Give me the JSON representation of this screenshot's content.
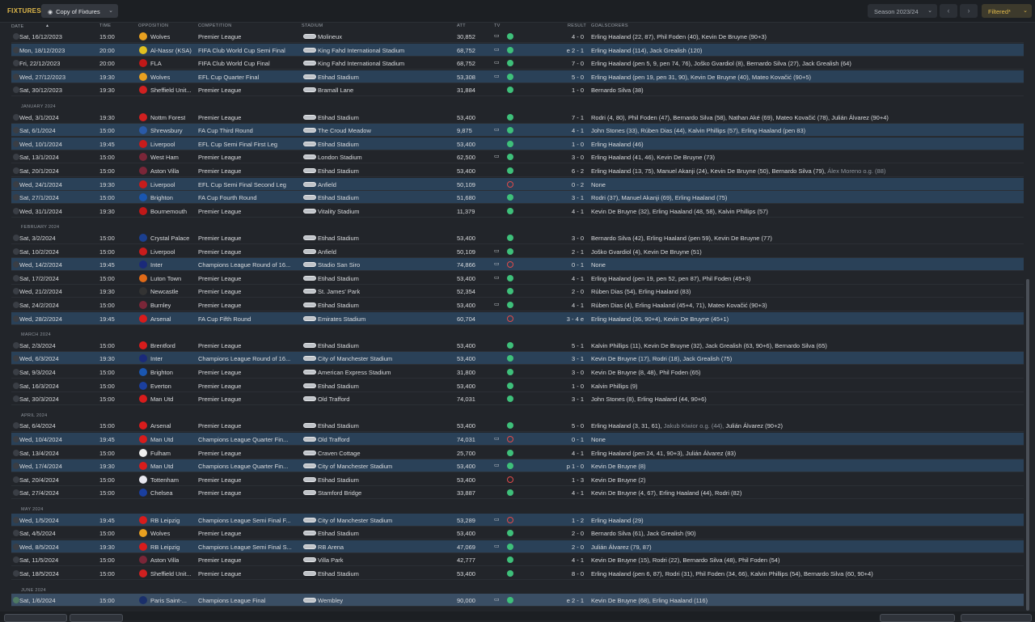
{
  "header": {
    "title": "FIXTURES",
    "view_dropdown": "Copy of Fixtures",
    "season": "Season 2023/24",
    "filter": "Filtered*"
  },
  "columns": {
    "date": "DATE",
    "time": "TIME",
    "opposition": "OPPOSITION",
    "competition": "COMPETITION",
    "stadium": "STADIUM",
    "att": "ATT",
    "tv": "TV",
    "result": "RESULT",
    "goalscorers": "GOALSCORERS"
  },
  "rows": [
    {
      "date": "Sat, 16/12/2023",
      "time": "15:00",
      "opp": "Wolves",
      "comp": "Premier League",
      "stadium": "Molineux",
      "att": "30,852",
      "tv": true,
      "outcome": "win",
      "result": "4 - 0",
      "scorers": "Erling Haaland (22, 87), Phil Foden (40), Kevin De Bruyne (90+3)",
      "badge": "#e8a020",
      "alt": false
    },
    {
      "date": "Mon, 18/12/2023",
      "time": "20:00",
      "opp": "Al-Nassr (KSA)",
      "comp": "FIFA Club World Cup Semi Final",
      "stadium": "King Fahd International Stadium",
      "att": "68,752",
      "tv": true,
      "outcome": "win",
      "result": "e 2 - 1",
      "scorers": "Erling Haaland (114), Jack Grealish (120)",
      "badge": "#e0c020",
      "alt": true
    },
    {
      "date": "Fri, 22/12/2023",
      "time": "20:00",
      "opp": "FLA",
      "comp": "FIFA Club World Cup Final",
      "stadium": "King Fahd International Stadium",
      "att": "68,752",
      "tv": true,
      "outcome": "win",
      "result": "7 - 0",
      "scorers": "Erling Haaland (pen 5, 9, pen 74, 76), Joško Gvardiol (8), Bernardo Silva (27), Jack Grealish (64)",
      "badge": "#c01818",
      "alt": false
    },
    {
      "date": "Wed, 27/12/2023",
      "time": "19:30",
      "opp": "Wolves",
      "comp": "EFL Cup Quarter Final",
      "stadium": "Etihad Stadium",
      "att": "53,308",
      "tv": true,
      "outcome": "win",
      "result": "5 - 0",
      "scorers": "Erling Haaland (pen 19, pen 31, 90), Kevin De Bruyne (40), Mateo Kovačić (90+5)",
      "badge": "#e8a020",
      "alt": true
    },
    {
      "date": "Sat, 30/12/2023",
      "time": "19:30",
      "opp": "Sheffield Unit...",
      "comp": "Premier League",
      "stadium": "Bramall Lane",
      "att": "31,884",
      "tv": false,
      "outcome": "win",
      "result": "1 - 0",
      "scorers": "Bernardo Silva (38)",
      "badge": "#d02020",
      "alt": false
    },
    {
      "month": "JANUARY 2024"
    },
    {
      "date": "Wed, 3/1/2024",
      "time": "19:30",
      "opp": "Nottm Forest",
      "comp": "Premier League",
      "stadium": "Etihad Stadium",
      "att": "53,400",
      "tv": false,
      "outcome": "win",
      "result": "7 - 1",
      "scorers": "Rodri (4, 80), Phil Foden (47), Bernardo Silva (58), Nathan Aké (69), Mateo Kovačić (78), Julián Álvarez (90+4)",
      "badge": "#d02020",
      "alt": false
    },
    {
      "date": "Sat, 6/1/2024",
      "time": "15:00",
      "opp": "Shrewsbury",
      "comp": "FA Cup Third Round",
      "stadium": "The Croud Meadow",
      "att": "9,875",
      "tv": true,
      "outcome": "win",
      "result": "4 - 1",
      "scorers": "John Stones (33), Rúben Dias (44), Kalvin Phillips (57), Erling Haaland (pen 83)",
      "badge": "#2a5aa8",
      "alt": true
    },
    {
      "date": "Wed, 10/1/2024",
      "time": "19:45",
      "opp": "Liverpool",
      "comp": "EFL Cup Semi Final First Leg",
      "stadium": "Etihad Stadium",
      "att": "53,400",
      "tv": false,
      "outcome": "win",
      "result": "1 - 0",
      "scorers": "Erling Haaland (46)",
      "badge": "#c81c1c",
      "alt": true
    },
    {
      "date": "Sat, 13/1/2024",
      "time": "15:00",
      "opp": "West Ham",
      "comp": "Premier League",
      "stadium": "London Stadium",
      "att": "62,500",
      "tv": true,
      "outcome": "win",
      "result": "3 - 0",
      "scorers": "Erling Haaland (41, 46), Kevin De Bruyne (73)",
      "badge": "#7a2638",
      "alt": false
    },
    {
      "date": "Sat, 20/1/2024",
      "time": "15:00",
      "opp": "Aston Villa",
      "comp": "Premier League",
      "stadium": "Etihad Stadium",
      "att": "53,400",
      "tv": false,
      "outcome": "win",
      "result": "6 - 2",
      "scorers": "Erling Haaland (13, 75), Manuel Akanji (24), Kevin De Bruyne (50), Bernardo Silva (79),",
      "scorers_muted": " Álex Moreno o.g. (88)",
      "badge": "#7a2638",
      "alt": false
    },
    {
      "date": "Wed, 24/1/2024",
      "time": "19:30",
      "opp": "Liverpool",
      "comp": "EFL Cup Semi Final Second Leg",
      "stadium": "Anfield",
      "att": "50,109",
      "tv": false,
      "outcome": "loss",
      "result": "0 - 2",
      "scorers": "None",
      "badge": "#c81c1c",
      "alt": true
    },
    {
      "date": "Sat, 27/1/2024",
      "time": "15:00",
      "opp": "Brighton",
      "comp": "FA Cup Fourth Round",
      "stadium": "Etihad Stadium",
      "att": "51,680",
      "tv": false,
      "outcome": "win",
      "result": "3 - 1",
      "scorers": "Rodri (37), Manuel Akanji (69), Erling Haaland (75)",
      "badge": "#1a56b0",
      "alt": true
    },
    {
      "date": "Wed, 31/1/2024",
      "time": "19:30",
      "opp": "Bournemouth",
      "comp": "Premier League",
      "stadium": "Vitality Stadium",
      "att": "11,379",
      "tv": false,
      "outcome": "win",
      "result": "4 - 1",
      "scorers": "Kevin De Bruyne (32), Erling Haaland (48, 58), Kalvin Phillips (57)",
      "badge": "#c01818",
      "alt": false
    },
    {
      "month": "FEBRUARY 2024"
    },
    {
      "date": "Sat, 3/2/2024",
      "time": "15:00",
      "opp": "Crystal Palace",
      "comp": "Premier League",
      "stadium": "Etihad Stadium",
      "att": "53,400",
      "tv": false,
      "outcome": "win",
      "result": "3 - 0",
      "scorers": "Bernardo Silva (42), Erling Haaland (pen 59), Kevin De Bruyne (77)",
      "badge": "#1b3f8f",
      "alt": false
    },
    {
      "date": "Sat, 10/2/2024",
      "time": "15:00",
      "opp": "Liverpool",
      "comp": "Premier League",
      "stadium": "Anfield",
      "att": "50,109",
      "tv": true,
      "outcome": "win",
      "result": "2 - 1",
      "scorers": "Joško Gvardiol (4), Kevin De Bruyne (51)",
      "badge": "#c81c1c",
      "alt": false
    },
    {
      "date": "Wed, 14/2/2024",
      "time": "19:45",
      "opp": "Inter",
      "comp": "Champions League Round of 16...",
      "stadium": "Stadio San Siro",
      "att": "74,866",
      "tv": true,
      "outcome": "loss",
      "result": "0 - 1",
      "scorers": "None",
      "badge": "#1a2a7a",
      "alt": true
    },
    {
      "date": "Sat, 17/2/2024",
      "time": "15:00",
      "opp": "Luton Town",
      "comp": "Premier League",
      "stadium": "Etihad Stadium",
      "att": "53,400",
      "tv": true,
      "outcome": "win",
      "result": "4 - 1",
      "scorers": "Erling Haaland (pen 19, pen 52, pen 87), Phil Foden (45+3)",
      "badge": "#e06a18",
      "alt": false
    },
    {
      "date": "Wed, 21/2/2024",
      "time": "19:30",
      "opp": "Newcastle",
      "comp": "Premier League",
      "stadium": "St. James' Park",
      "att": "52,354",
      "tv": false,
      "outcome": "win",
      "result": "2 - 0",
      "scorers": "Rúben Dias (54), Erling Haaland (83)",
      "badge": "#333333",
      "alt": false
    },
    {
      "date": "Sat, 24/2/2024",
      "time": "15:00",
      "opp": "Burnley",
      "comp": "Premier League",
      "stadium": "Etihad Stadium",
      "att": "53,400",
      "tv": true,
      "outcome": "win",
      "result": "4 - 1",
      "scorers": "Rúben Dias (4), Erling Haaland (45+4, 71), Mateo Kovačić (90+3)",
      "badge": "#7a2638",
      "alt": false
    },
    {
      "date": "Wed, 28/2/2024",
      "time": "19:45",
      "opp": "Arsenal",
      "comp": "FA Cup Fifth Round",
      "stadium": "Emirates Stadium",
      "att": "60,704",
      "tv": false,
      "outcome": "loss",
      "result": "3 - 4 e",
      "scorers": "Erling Haaland (36, 90+4), Kevin De Bruyne (45+1)",
      "badge": "#d81c1c",
      "alt": true
    },
    {
      "month": "MARCH 2024"
    },
    {
      "date": "Sat, 2/3/2024",
      "time": "15:00",
      "opp": "Brentford",
      "comp": "Premier League",
      "stadium": "Etihad Stadium",
      "att": "53,400",
      "tv": false,
      "outcome": "win",
      "result": "5 - 1",
      "scorers": "Kalvin Phillips (11), Kevin De Bruyne (32), Jack Grealish (63, 90+6), Bernardo Silva (65)",
      "badge": "#d81c1c",
      "alt": false
    },
    {
      "date": "Wed, 6/3/2024",
      "time": "19:30",
      "opp": "Inter",
      "comp": "Champions League Round of 16...",
      "stadium": "City of Manchester Stadium",
      "att": "53,400",
      "tv": false,
      "outcome": "win",
      "result": "3 - 1",
      "scorers": "Kevin De Bruyne (17), Rodri (18), Jack Grealish (75)",
      "badge": "#1a2a7a",
      "alt": true
    },
    {
      "date": "Sat, 9/3/2024",
      "time": "15:00",
      "opp": "Brighton",
      "comp": "Premier League",
      "stadium": "American Express Stadium",
      "att": "31,800",
      "tv": false,
      "outcome": "win",
      "result": "3 - 0",
      "scorers": "Kevin De Bruyne (8, 48), Phil Foden (65)",
      "badge": "#1a56b0",
      "alt": false
    },
    {
      "date": "Sat, 16/3/2024",
      "time": "15:00",
      "opp": "Everton",
      "comp": "Premier League",
      "stadium": "Etihad Stadium",
      "att": "53,400",
      "tv": false,
      "outcome": "win",
      "result": "1 - 0",
      "scorers": "Kalvin Phillips (9)",
      "badge": "#1b3f9f",
      "alt": false
    },
    {
      "date": "Sat, 30/3/2024",
      "time": "15:00",
      "opp": "Man Utd",
      "comp": "Premier League",
      "stadium": "Old Trafford",
      "att": "74,031",
      "tv": false,
      "outcome": "win",
      "result": "3 - 1",
      "scorers": "John Stones (8), Erling Haaland (44, 90+6)",
      "badge": "#d81c1c",
      "alt": false
    },
    {
      "month": "APRIL 2024"
    },
    {
      "date": "Sat, 6/4/2024",
      "time": "15:00",
      "opp": "Arsenal",
      "comp": "Premier League",
      "stadium": "Etihad Stadium",
      "att": "53,400",
      "tv": false,
      "outcome": "win",
      "result": "5 - 0",
      "scorers": "Erling Haaland (3, 31, 61),",
      "scorers_muted": " Jakub Kiwior o.g. (44),",
      "scorers_tail": " Julián Álvarez (90+2)",
      "badge": "#d81c1c",
      "alt": false
    },
    {
      "date": "Wed, 10/4/2024",
      "time": "19:45",
      "opp": "Man Utd",
      "comp": "Champions League Quarter Fin...",
      "stadium": "Old Trafford",
      "att": "74,031",
      "tv": true,
      "outcome": "loss",
      "result": "0 - 1",
      "scorers": "None",
      "badge": "#d81c1c",
      "alt": true
    },
    {
      "date": "Sat, 13/4/2024",
      "time": "15:00",
      "opp": "Fulham",
      "comp": "Premier League",
      "stadium": "Craven Cottage",
      "att": "25,700",
      "tv": false,
      "outcome": "win",
      "result": "4 - 1",
      "scorers": "Erling Haaland (pen 24, 41, 90+3), Julián Álvarez (83)",
      "badge": "#eeeeee",
      "alt": false
    },
    {
      "date": "Wed, 17/4/2024",
      "time": "19:30",
      "opp": "Man Utd",
      "comp": "Champions League Quarter Fin...",
      "stadium": "City of Manchester Stadium",
      "att": "53,400",
      "tv": true,
      "outcome": "win",
      "result": "p 1 - 0",
      "scorers": "Kevin De Bruyne (8)",
      "badge": "#d81c1c",
      "alt": true
    },
    {
      "date": "Sat, 20/4/2024",
      "time": "15:00",
      "opp": "Tottenham",
      "comp": "Premier League",
      "stadium": "Etihad Stadium",
      "att": "53,400",
      "tv": false,
      "outcome": "loss",
      "result": "1 - 3",
      "scorers": "Kevin De Bruyne (2)",
      "badge": "#e8e8f0",
      "alt": false
    },
    {
      "date": "Sat, 27/4/2024",
      "time": "15:00",
      "opp": "Chelsea",
      "comp": "Premier League",
      "stadium": "Stamford Bridge",
      "att": "33,887",
      "tv": false,
      "outcome": "win",
      "result": "4 - 1",
      "scorers": "Kevin De Bruyne (4, 67), Erling Haaland (44), Rodri (82)",
      "badge": "#1a3fa0",
      "alt": false
    },
    {
      "month": "MAY 2024"
    },
    {
      "date": "Wed, 1/5/2024",
      "time": "19:45",
      "opp": "RB Leipzig",
      "comp": "Champions League Semi Final F...",
      "stadium": "City of Manchester Stadium",
      "att": "53,289",
      "tv": true,
      "outcome": "loss",
      "result": "1 - 2",
      "scorers": "Erling Haaland (29)",
      "badge": "#d81c1c",
      "alt": true
    },
    {
      "date": "Sat, 4/5/2024",
      "time": "15:00",
      "opp": "Wolves",
      "comp": "Premier League",
      "stadium": "Etihad Stadium",
      "att": "53,400",
      "tv": false,
      "outcome": "win",
      "result": "2 - 0",
      "scorers": "Bernardo Silva (61), Jack Grealish (90)",
      "badge": "#e8a020",
      "alt": false
    },
    {
      "date": "Wed, 8/5/2024",
      "time": "19:30",
      "opp": "RB Leipzig",
      "comp": "Champions League Semi Final S...",
      "stadium": "RB Arena",
      "att": "47,069",
      "tv": true,
      "outcome": "win",
      "result": "2 - 0",
      "scorers": "Julián Álvarez (79, 87)",
      "badge": "#d81c1c",
      "alt": true
    },
    {
      "date": "Sat, 11/5/2024",
      "time": "15:00",
      "opp": "Aston Villa",
      "comp": "Premier League",
      "stadium": "Villa Park",
      "att": "42,777",
      "tv": false,
      "outcome": "win",
      "result": "4 - 1",
      "scorers": "Kevin De Bruyne (15), Rodri (22), Bernardo Silva (48), Phil Foden (54)",
      "badge": "#7a2638",
      "alt": false
    },
    {
      "date": "Sat, 18/5/2024",
      "time": "15:00",
      "opp": "Sheffield Unit...",
      "comp": "Premier League",
      "stadium": "Etihad Stadium",
      "att": "53,400",
      "tv": false,
      "outcome": "win",
      "result": "8 - 0",
      "scorers": "Erling Haaland (pen 6, 87), Rodri (31), Phil Foden (34, 66), Kalvin Phillips (54), Bernardo Silva (60, 90+4)",
      "badge": "#d02020",
      "alt": false
    },
    {
      "month": "JUNE 2024"
    },
    {
      "date": "Sat, 1/6/2024",
      "time": "15:00",
      "opp": "Paris Saint-...",
      "comp": "Champions League Final",
      "stadium": "Wembley",
      "att": "90,000",
      "tv": true,
      "outcome": "win",
      "result": "e 2 - 1",
      "scorers": "Kevin De Bruyne (68), Erling Haaland (116)",
      "badge": "#1a2f6a",
      "alt": "last"
    }
  ],
  "colors": {
    "accent": "#e0b94b",
    "alt_row": "#2a4158",
    "win": "#3ec07a",
    "loss": "#e04b4b"
  },
  "icons": {
    "tv": "tv-icon",
    "view": "eye-icon",
    "prev": "chevron-left-icon",
    "next": "chevron-right-icon"
  }
}
